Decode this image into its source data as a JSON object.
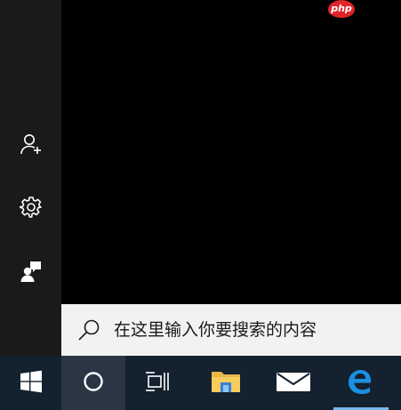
{
  "search": {
    "placeholder": "在这里输入你要搜索的内容",
    "value": ""
  },
  "watermark": {
    "text": "php"
  },
  "rail": {
    "items": [
      {
        "icon": "add-user-icon"
      },
      {
        "icon": "gear-icon"
      },
      {
        "icon": "feedback-icon"
      }
    ]
  },
  "taskbar": {
    "items": [
      {
        "icon": "windows-logo-icon"
      },
      {
        "icon": "cortana-circle-icon",
        "active": true
      },
      {
        "icon": "task-view-icon"
      },
      {
        "icon": "folder-icon"
      },
      {
        "icon": "mail-icon"
      },
      {
        "icon": "edge-icon",
        "running": true
      }
    ]
  },
  "colors": {
    "rail_bg": "#1a1a1a",
    "results_bg": "#000000",
    "searchbox_bg": "#f2f2f2",
    "taskbar_bg": "#14212e",
    "taskbar_active": "#2a3644",
    "accent": "#0078d7",
    "running_indicator": "#76b9ed"
  }
}
